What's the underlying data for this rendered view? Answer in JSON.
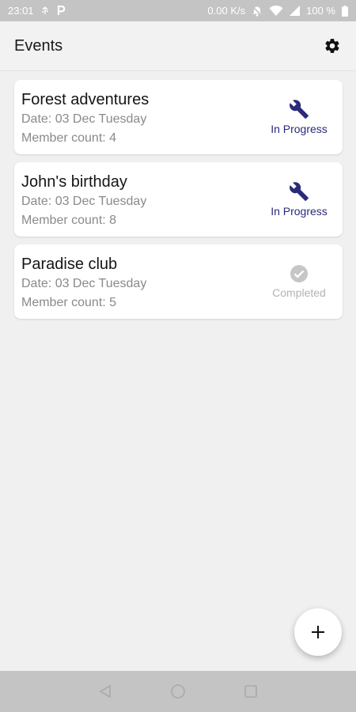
{
  "status_bar": {
    "time": "23:01",
    "network_speed": "0.00 K/s",
    "battery": "100 %",
    "icons": [
      "usb-icon",
      "parking-icon",
      "notifications-off-icon",
      "wifi-icon",
      "signal-icon",
      "battery-icon"
    ]
  },
  "app_bar": {
    "title": "Events",
    "settings_icon": "gear-icon"
  },
  "events": [
    {
      "name": "Forest adventures",
      "date": "Date: 03 Dec Tuesday",
      "members": "Member count: 4",
      "status": "In Progress",
      "status_icon": "wrench-icon"
    },
    {
      "name": "John's birthday",
      "date": "Date: 03 Dec Tuesday",
      "members": "Member count: 8",
      "status": "In Progress",
      "status_icon": "wrench-icon"
    },
    {
      "name": "Paradise club",
      "date": "Date: 03 Dec Tuesday",
      "members": "Member count: 5",
      "status": "Completed",
      "status_icon": "check-circle-icon"
    }
  ],
  "fab": {
    "icon": "plus-icon"
  },
  "nav_bar": {
    "icons": [
      "back-icon",
      "home-icon",
      "recents-icon"
    ]
  },
  "colors": {
    "in_progress": "#2b2a7a",
    "completed": "#b3b3b3",
    "system_bars": "#c4c4c4",
    "background": "#f0f0f0"
  }
}
